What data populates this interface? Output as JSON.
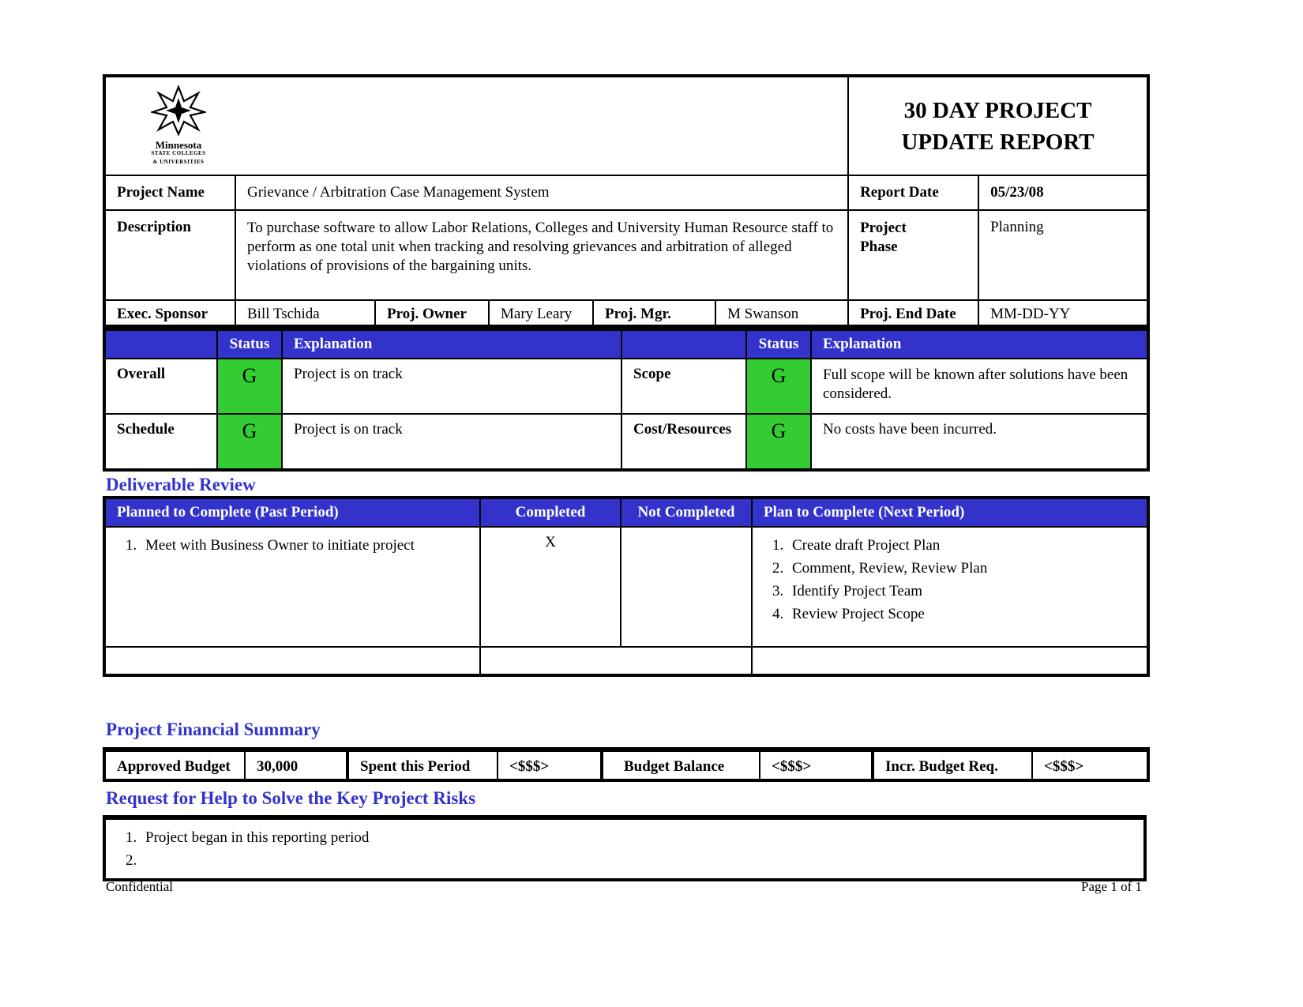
{
  "header": {
    "logo": {
      "org": "Minnesota",
      "line2": "STATE COLLEGES",
      "line3": "& UNIVERSITIES"
    },
    "title_line1": "30 DAY PROJECT",
    "title_line2": "UPDATE REPORT"
  },
  "project": {
    "name_label": "Project Name",
    "name_value": "Grievance / Arbitration Case Management System",
    "report_date_label": "Report Date",
    "report_date_value": "05/23/08",
    "description_label": "Description",
    "description_value": "To purchase software to allow Labor Relations, Colleges and University Human Resource staff to perform as one total unit when tracking and resolving grievances and arbitration of alleged violations of provisions of the bargaining units.",
    "phase_label_line1": "Project",
    "phase_label_line2": "Phase",
    "phase_value": "Planning",
    "exec_sponsor_label": "Exec. Sponsor",
    "exec_sponsor_value": "Bill Tschida",
    "owner_label": "Proj. Owner",
    "owner_value": "Mary Leary",
    "mgr_label": "Proj. Mgr.",
    "mgr_value": "M Swanson",
    "end_date_label": "Proj. End Date",
    "end_date_value": "MM-DD-YY"
  },
  "status": {
    "headers": {
      "status": "Status",
      "explanation": "Explanation"
    },
    "colors": {
      "header": "#3333cc",
      "green": "#33cc33"
    },
    "rows": [
      {
        "left": {
          "label": "Overall",
          "status": "G",
          "explanation": "Project is on track"
        },
        "right": {
          "label": "Scope",
          "status": "G",
          "explanation": "Full scope will be known after solutions have been considered."
        }
      },
      {
        "left": {
          "label": "Schedule",
          "status": "G",
          "explanation": "Project is on track"
        },
        "right": {
          "label": "Cost/Resources",
          "status": "G",
          "explanation": "No costs have been incurred."
        }
      }
    ]
  },
  "deliverables": {
    "title": "Deliverable Review",
    "headers": [
      "Planned to Complete (Past Period)",
      "Completed",
      "Not Completed",
      "Plan to Complete (Next Period)"
    ],
    "past": [
      "Meet with Business Owner to initiate project"
    ],
    "completed_mark": "X",
    "not_completed": "",
    "next": [
      "Create draft Project Plan",
      "Comment, Review, Review Plan",
      "Identify Project Team",
      "Review Project Scope"
    ]
  },
  "financial": {
    "title": "Project Financial Summary",
    "approved_budget_label": "Approved Budget",
    "approved_budget_value": "30,000",
    "spent_label": "Spent this Period",
    "spent_value": "<$$$>",
    "balance_label": "Budget Balance",
    "balance_value": "<$$$>",
    "incr_label": "Incr. Budget Req.",
    "incr_value": "<$$$>"
  },
  "risks": {
    "title": "Request for Help to Solve the Key Project Risks",
    "items": [
      "Project began in this reporting period",
      ""
    ]
  },
  "footer": {
    "left": "Confidential",
    "right": "Page 1 of 1"
  }
}
